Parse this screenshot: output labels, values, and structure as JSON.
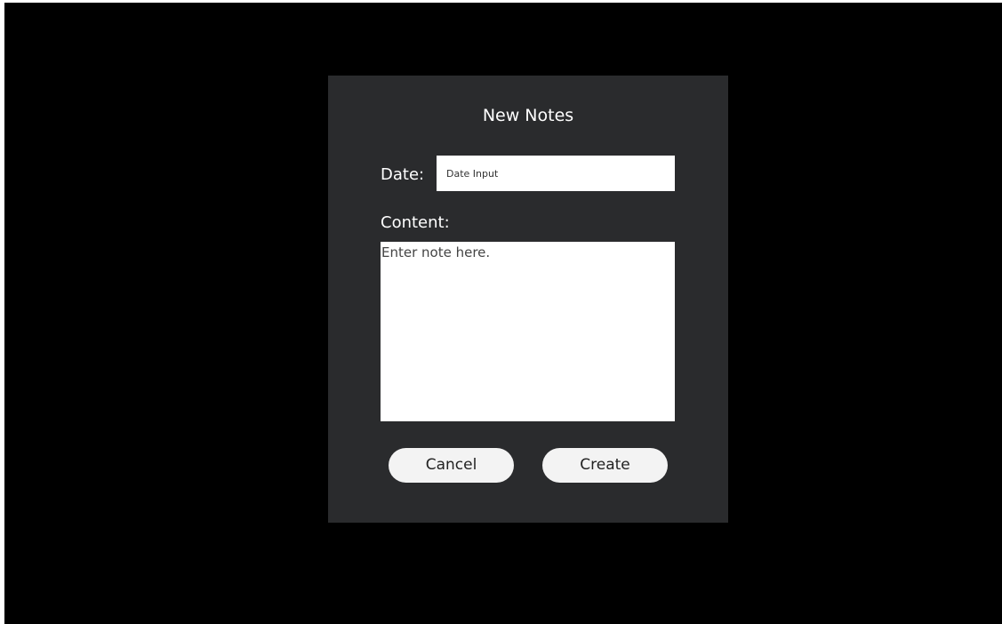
{
  "dialog": {
    "title": "New Notes",
    "date": {
      "label": "Date:",
      "placeholder": "Date Input",
      "value": ""
    },
    "content": {
      "label": "Content:",
      "placeholder": "Enter note here.",
      "value": ""
    },
    "buttons": {
      "cancel_label": "Cancel",
      "create_label": "Create"
    }
  },
  "colors": {
    "screen_background": "#000000",
    "dialog_background": "#2a2b2d",
    "text_light": "#ffffff",
    "button_background": "#f3f3f3"
  }
}
